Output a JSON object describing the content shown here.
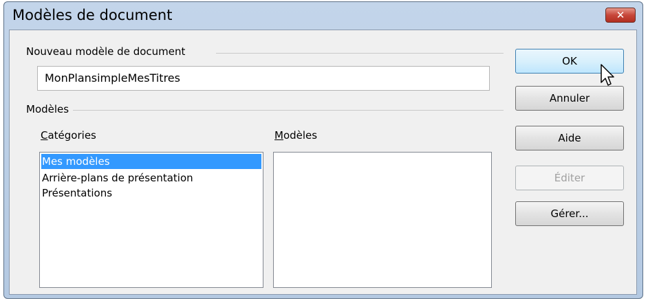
{
  "window": {
    "title": "Modèles de document",
    "close_glyph": "✕"
  },
  "new_template": {
    "group_label": "Nouveau modèle de document",
    "name_value": "MonPlansimpleMesTitres"
  },
  "templates": {
    "group_label": "Modèles",
    "categories_label": "Catégories",
    "templates_label": "Modèles",
    "categories": [
      "Mes modèles",
      "Arrière-plans de présentation",
      "Présentations"
    ],
    "selected_category": "Mes modèles"
  },
  "buttons": {
    "ok": "OK",
    "cancel": "Annuler",
    "help": "Aide",
    "edit": "Éditer",
    "manage": "Gérer..."
  },
  "colors": {
    "accent": "#3399ff",
    "title_bar": "#bcd0e8",
    "close": "#c7473a"
  },
  "icons": {
    "close": "close-icon",
    "cursor": "pointer-cursor-icon"
  }
}
